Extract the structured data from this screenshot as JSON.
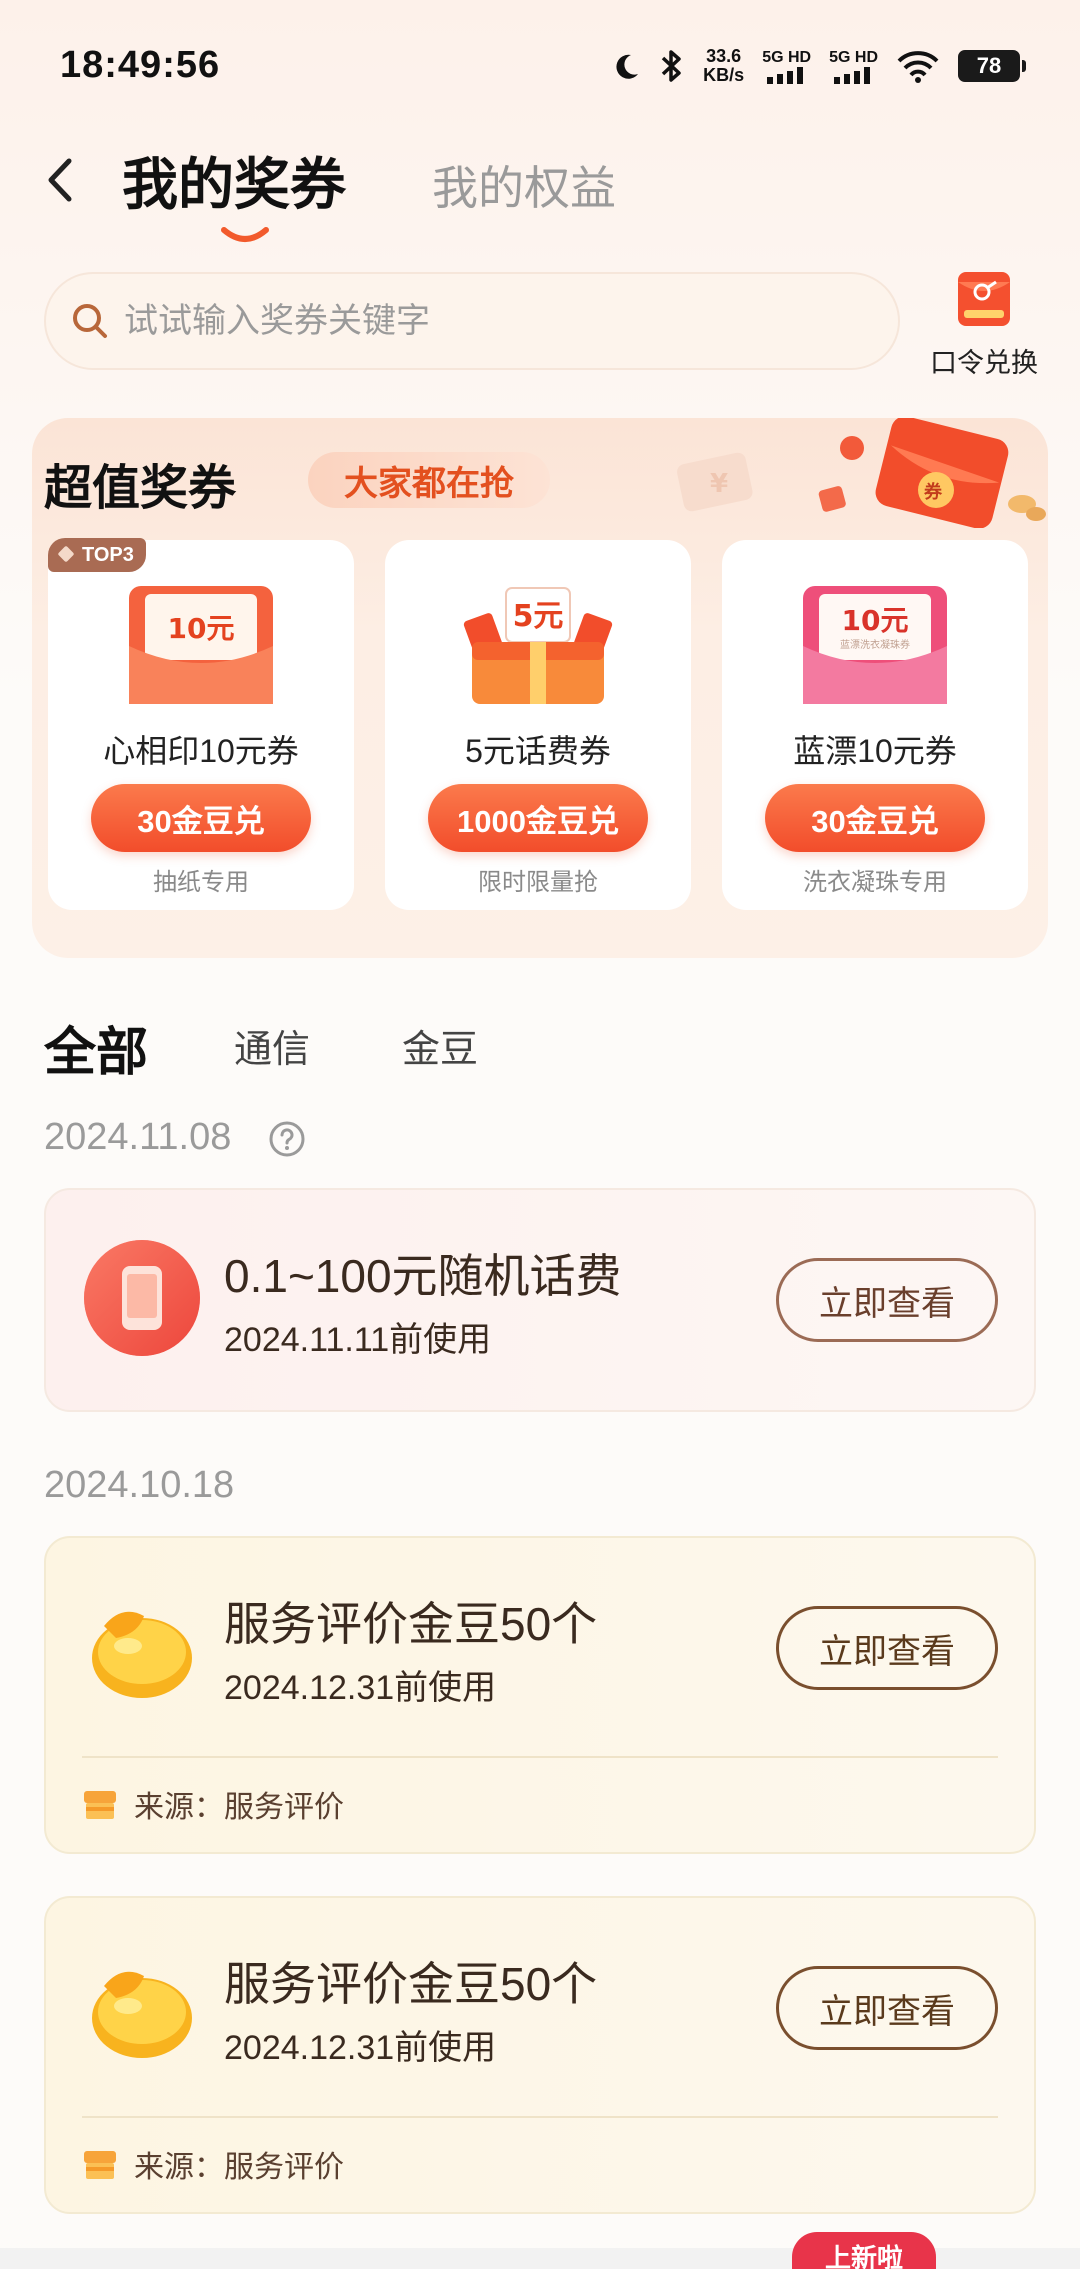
{
  "status_bar": {
    "time": "18:49:56",
    "speed_value": "33.6",
    "speed_unit": "KB/s",
    "sim1": "5G HD",
    "sim2": "5G HD",
    "battery": "78"
  },
  "header": {
    "tab_active": "我的奖券",
    "tab_inactive": "我的权益"
  },
  "search": {
    "placeholder": "试试输入奖券关键字"
  },
  "redeem": {
    "label": "口令兑换"
  },
  "promo": {
    "title": "超值奖券",
    "tag": "大家都在抢",
    "badge": "TOP3",
    "coupons": [
      {
        "img_text": "10元",
        "name": "心相印10元券",
        "button": "30金豆兑",
        "note": "抽纸专用"
      },
      {
        "img_text": "5元",
        "name": "5元话费券",
        "button": "1000金豆兑",
        "note": "限时限量抢"
      },
      {
        "img_text": "10元",
        "img_sub": "蓝漂洗衣凝珠券",
        "name": "蓝漂10元券",
        "button": "30金豆兑",
        "note": "洗衣凝珠专用"
      }
    ]
  },
  "filters": {
    "all": "全部",
    "telecom": "通信",
    "beans": "金豆"
  },
  "groups": [
    {
      "date": "2024.11.08",
      "items": [
        {
          "title": "0.1~100元随机话费",
          "expiry": "2024.11.11前使用",
          "button": "立即查看"
        }
      ]
    },
    {
      "date": "2024.10.18",
      "items": [
        {
          "title": "服务评价金豆50个",
          "expiry": "2024.12.31前使用",
          "button": "立即查看",
          "source": "来源：服务评价"
        },
        {
          "title": "服务评价金豆50个",
          "expiry": "2024.12.31前使用",
          "button": "立即查看",
          "source": "来源：服务评价"
        }
      ]
    }
  ],
  "new_badge": "上新啦",
  "colors": {
    "accent": "#f24d2b",
    "tag_text": "#e3501f",
    "card_border_btn": "#9b6b55"
  }
}
